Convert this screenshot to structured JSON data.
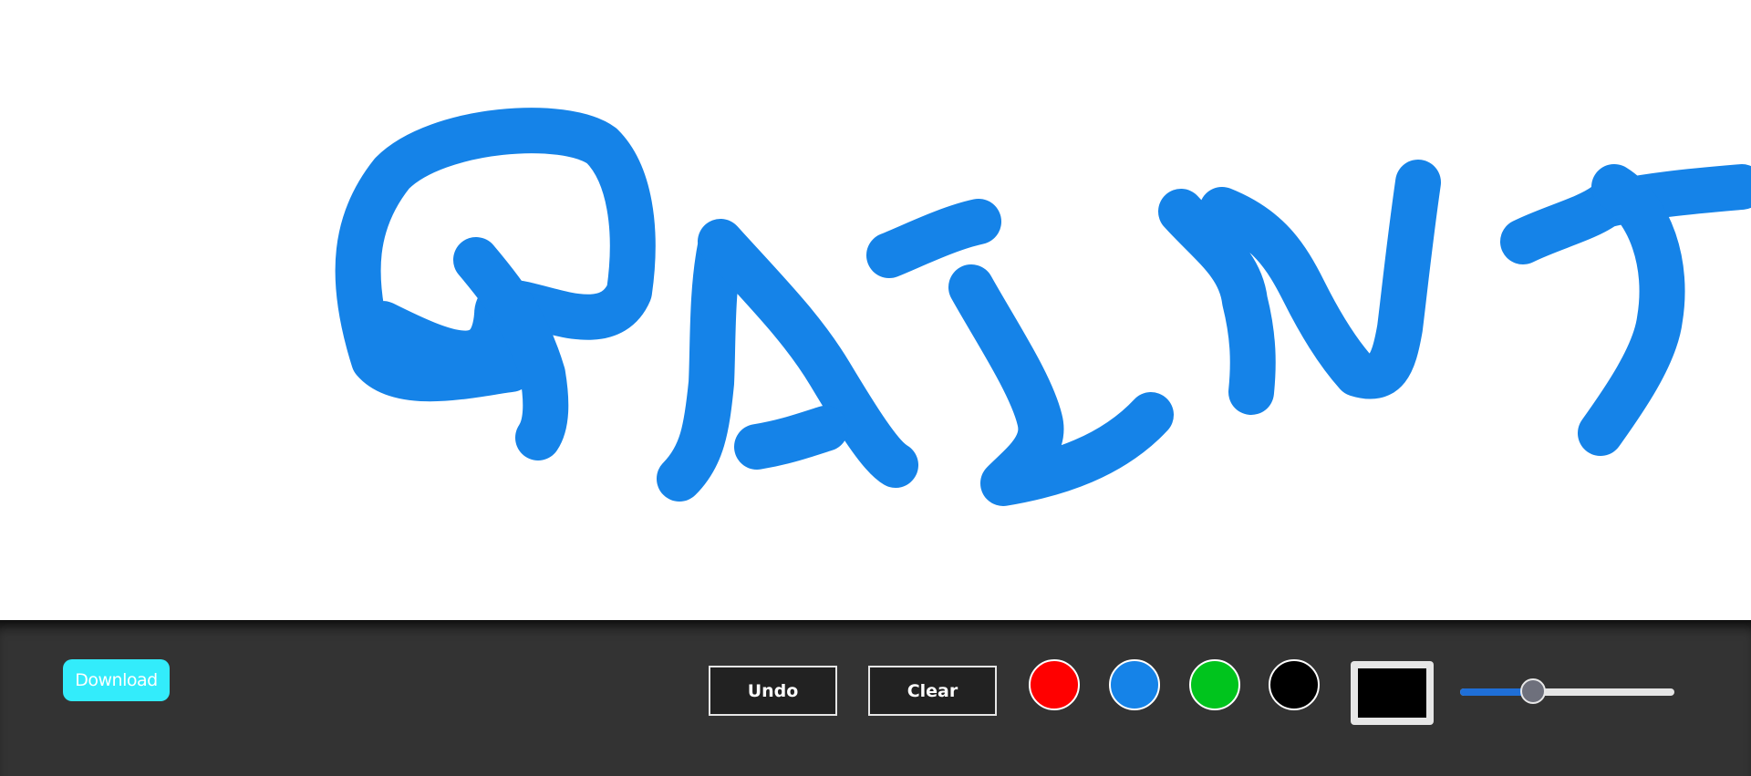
{
  "canvas": {
    "drawing_text": "PAINT",
    "stroke_color": "#1583e8"
  },
  "toolbar": {
    "download_label": "Download",
    "undo_label": "Undo",
    "clear_label": "Clear",
    "swatches": [
      {
        "name": "red",
        "color": "#ff0000"
      },
      {
        "name": "blue",
        "color": "#1583e8"
      },
      {
        "name": "green",
        "color": "#00c41d"
      },
      {
        "name": "black",
        "color": "#000000"
      }
    ],
    "color_picker_value": "#000000",
    "brush_size_fraction": 0.34,
    "accent_color": "#33ecfb"
  }
}
